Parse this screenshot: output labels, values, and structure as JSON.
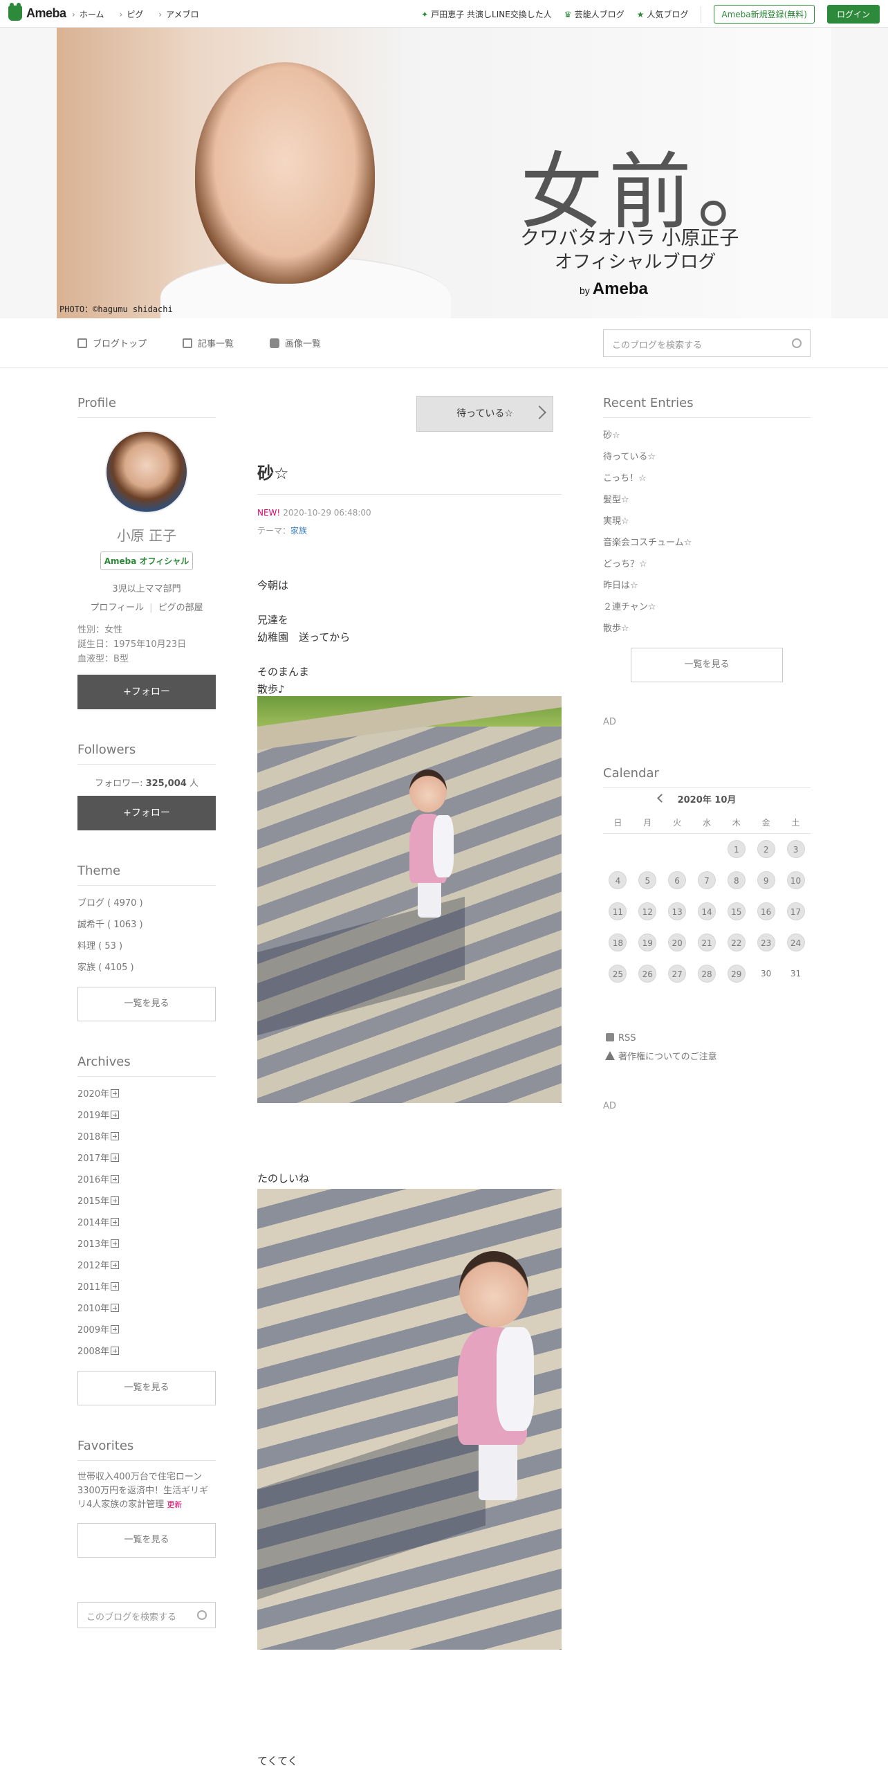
{
  "topbar": {
    "logo_text": "Ameba",
    "nav_left": [
      "ホーム",
      "ピグ",
      "アメブロ"
    ],
    "nav_right": [
      "戸田恵子 共演しLINE交換した人",
      "芸能人ブログ",
      "人気ブログ"
    ],
    "register_label": "Ameba新規登録(無料)",
    "login_label": "ログイン",
    "accent_color": "#2d8a3a"
  },
  "banner": {
    "title_big": "女前。",
    "title_sub1": "クワバタオハラ 小原正子",
    "title_sub2": "オフィシャルブログ",
    "by": "by",
    "brand": "Ameba",
    "credit": "PHOTO：©hagumu shidachi"
  },
  "blognav": {
    "tabs": [
      "ブログトップ",
      "記事一覧",
      "画像一覧"
    ],
    "search_placeholder": "このブログを検索する"
  },
  "profile": {
    "heading": "Profile",
    "name": "小原 正子",
    "badge": "Ameba オフィシャル",
    "desc": "3児以上ママ部門",
    "link_profile": "プロフィール",
    "link_room": "ピグの部屋",
    "gender": "性別：女性",
    "birthday": "誕生日：1975年10月23日",
    "blood": "血液型：B型",
    "follow_label": "+フォロー"
  },
  "followers": {
    "heading": "Followers",
    "count_label": "フォロワー: ",
    "count": "325,004",
    "unit": " 人",
    "follow_label": "+フォロー"
  },
  "theme": {
    "heading": "Theme",
    "items": [
      "ブログ ( 4970 )",
      "誠希千 ( 1063 )",
      "料理 ( 53 )",
      "家族 ( 4105 )"
    ],
    "more_label": "一覧を見る"
  },
  "archives": {
    "heading": "Archives",
    "years": [
      "2020年",
      "2019年",
      "2018年",
      "2017年",
      "2016年",
      "2015年",
      "2014年",
      "2013年",
      "2012年",
      "2011年",
      "2010年",
      "2009年",
      "2008年"
    ],
    "more_label": "一覧を見る"
  },
  "favorites": {
    "heading": "Favorites",
    "text": "世帯収入400万台で住宅ローン3300万円を返済中！生活ギリギリ4人家族の家計管理",
    "updated": "更新",
    "more_label": "一覧を見る",
    "search_placeholder": "このブログを検索する"
  },
  "post": {
    "next_label": "待っている☆",
    "title": "砂☆",
    "new_label": "NEW!",
    "datetime": "2020-10-29 06:48:00",
    "theme_label": "テーマ：",
    "theme_link": "家族",
    "body_lines": [
      "今朝は",
      "",
      "兄達を",
      "幼稚園　送ってから",
      "",
      "そのまんま",
      "散歩♪"
    ],
    "caption1": "たのしいね",
    "caption2": "てくてく"
  },
  "recent": {
    "heading": "Recent Entries",
    "items": [
      "砂☆",
      "待っている☆",
      "こっち！☆",
      "髪型☆",
      "実現☆",
      "音楽会コスチューム☆",
      "どっち？☆",
      "昨日は☆",
      "２連チャン☆",
      "散歩☆"
    ],
    "more_label": "一覧を見る"
  },
  "ad_label": "AD",
  "calendar": {
    "heading": "Calendar",
    "month": "2020年 10月",
    "weekdays": [
      "日",
      "月",
      "火",
      "水",
      "木",
      "金",
      "土"
    ],
    "weeks": [
      [
        "",
        "",
        "",
        "",
        "1",
        "2",
        "3"
      ],
      [
        "4",
        "5",
        "6",
        "7",
        "8",
        "9",
        "10"
      ],
      [
        "11",
        "12",
        "13",
        "14",
        "15",
        "16",
        "17"
      ],
      [
        "18",
        "19",
        "20",
        "21",
        "22",
        "23",
        "24"
      ],
      [
        "25",
        "26",
        "27",
        "28",
        "29",
        "30",
        "31"
      ]
    ],
    "active_through": 29
  },
  "footer_links": {
    "rss": "RSS",
    "copyright": "著作権についてのご注意"
  }
}
